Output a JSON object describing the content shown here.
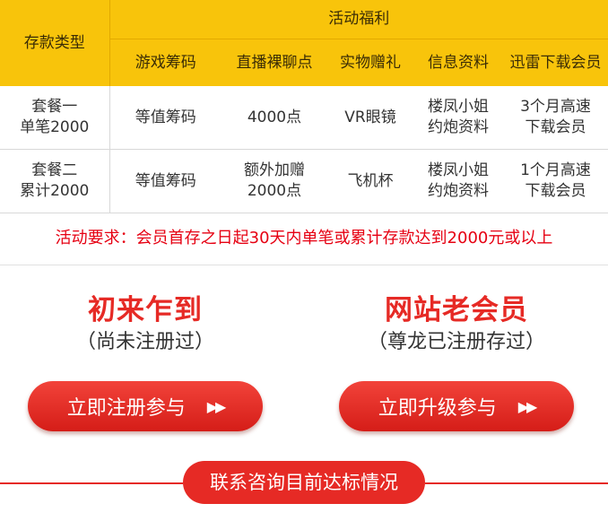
{
  "table": {
    "header": {
      "type_label": "存款类型",
      "activity_label": "活动福利",
      "columns": [
        "游戏筹码",
        "直播裸聊点",
        "实物赠礼",
        "信息资料",
        "迅雷下载会员"
      ]
    },
    "rows": [
      {
        "plan": [
          "套餐一",
          "单笔2000"
        ],
        "cells": [
          [
            "等值筹码"
          ],
          [
            "4000点"
          ],
          [
            "VR眼镜"
          ],
          [
            "楼凤小姐",
            "约炮资料"
          ],
          [
            "3个月高速",
            "下载会员"
          ]
        ]
      },
      {
        "plan": [
          "套餐二",
          "累计2000"
        ],
        "cells": [
          [
            "等值筹码"
          ],
          [
            "额外加赠",
            "2000点"
          ],
          [
            "飞机杯"
          ],
          [
            "楼凤小姐",
            "约炮资料"
          ],
          [
            "1个月高速",
            "下载会员"
          ]
        ]
      }
    ]
  },
  "requirement": "活动要求：会员首存之日起30天内单笔或累计存款达到2000元或以上",
  "cta_left": {
    "title": "初来乍到",
    "subtitle": "（尚未注册过）",
    "button": "立即注册参与"
  },
  "cta_right": {
    "title": "网站老会员",
    "subtitle": "（尊龙已注册存过）",
    "button": "立即升级参与"
  },
  "contact_button": "联系咨询目前达标情况",
  "icons": {
    "button_arrows": "double-right-arrow-icon"
  },
  "colors": {
    "header_bg": "#f8c40b",
    "accent_red": "#e62a25",
    "requirement_red": "#e60012"
  }
}
